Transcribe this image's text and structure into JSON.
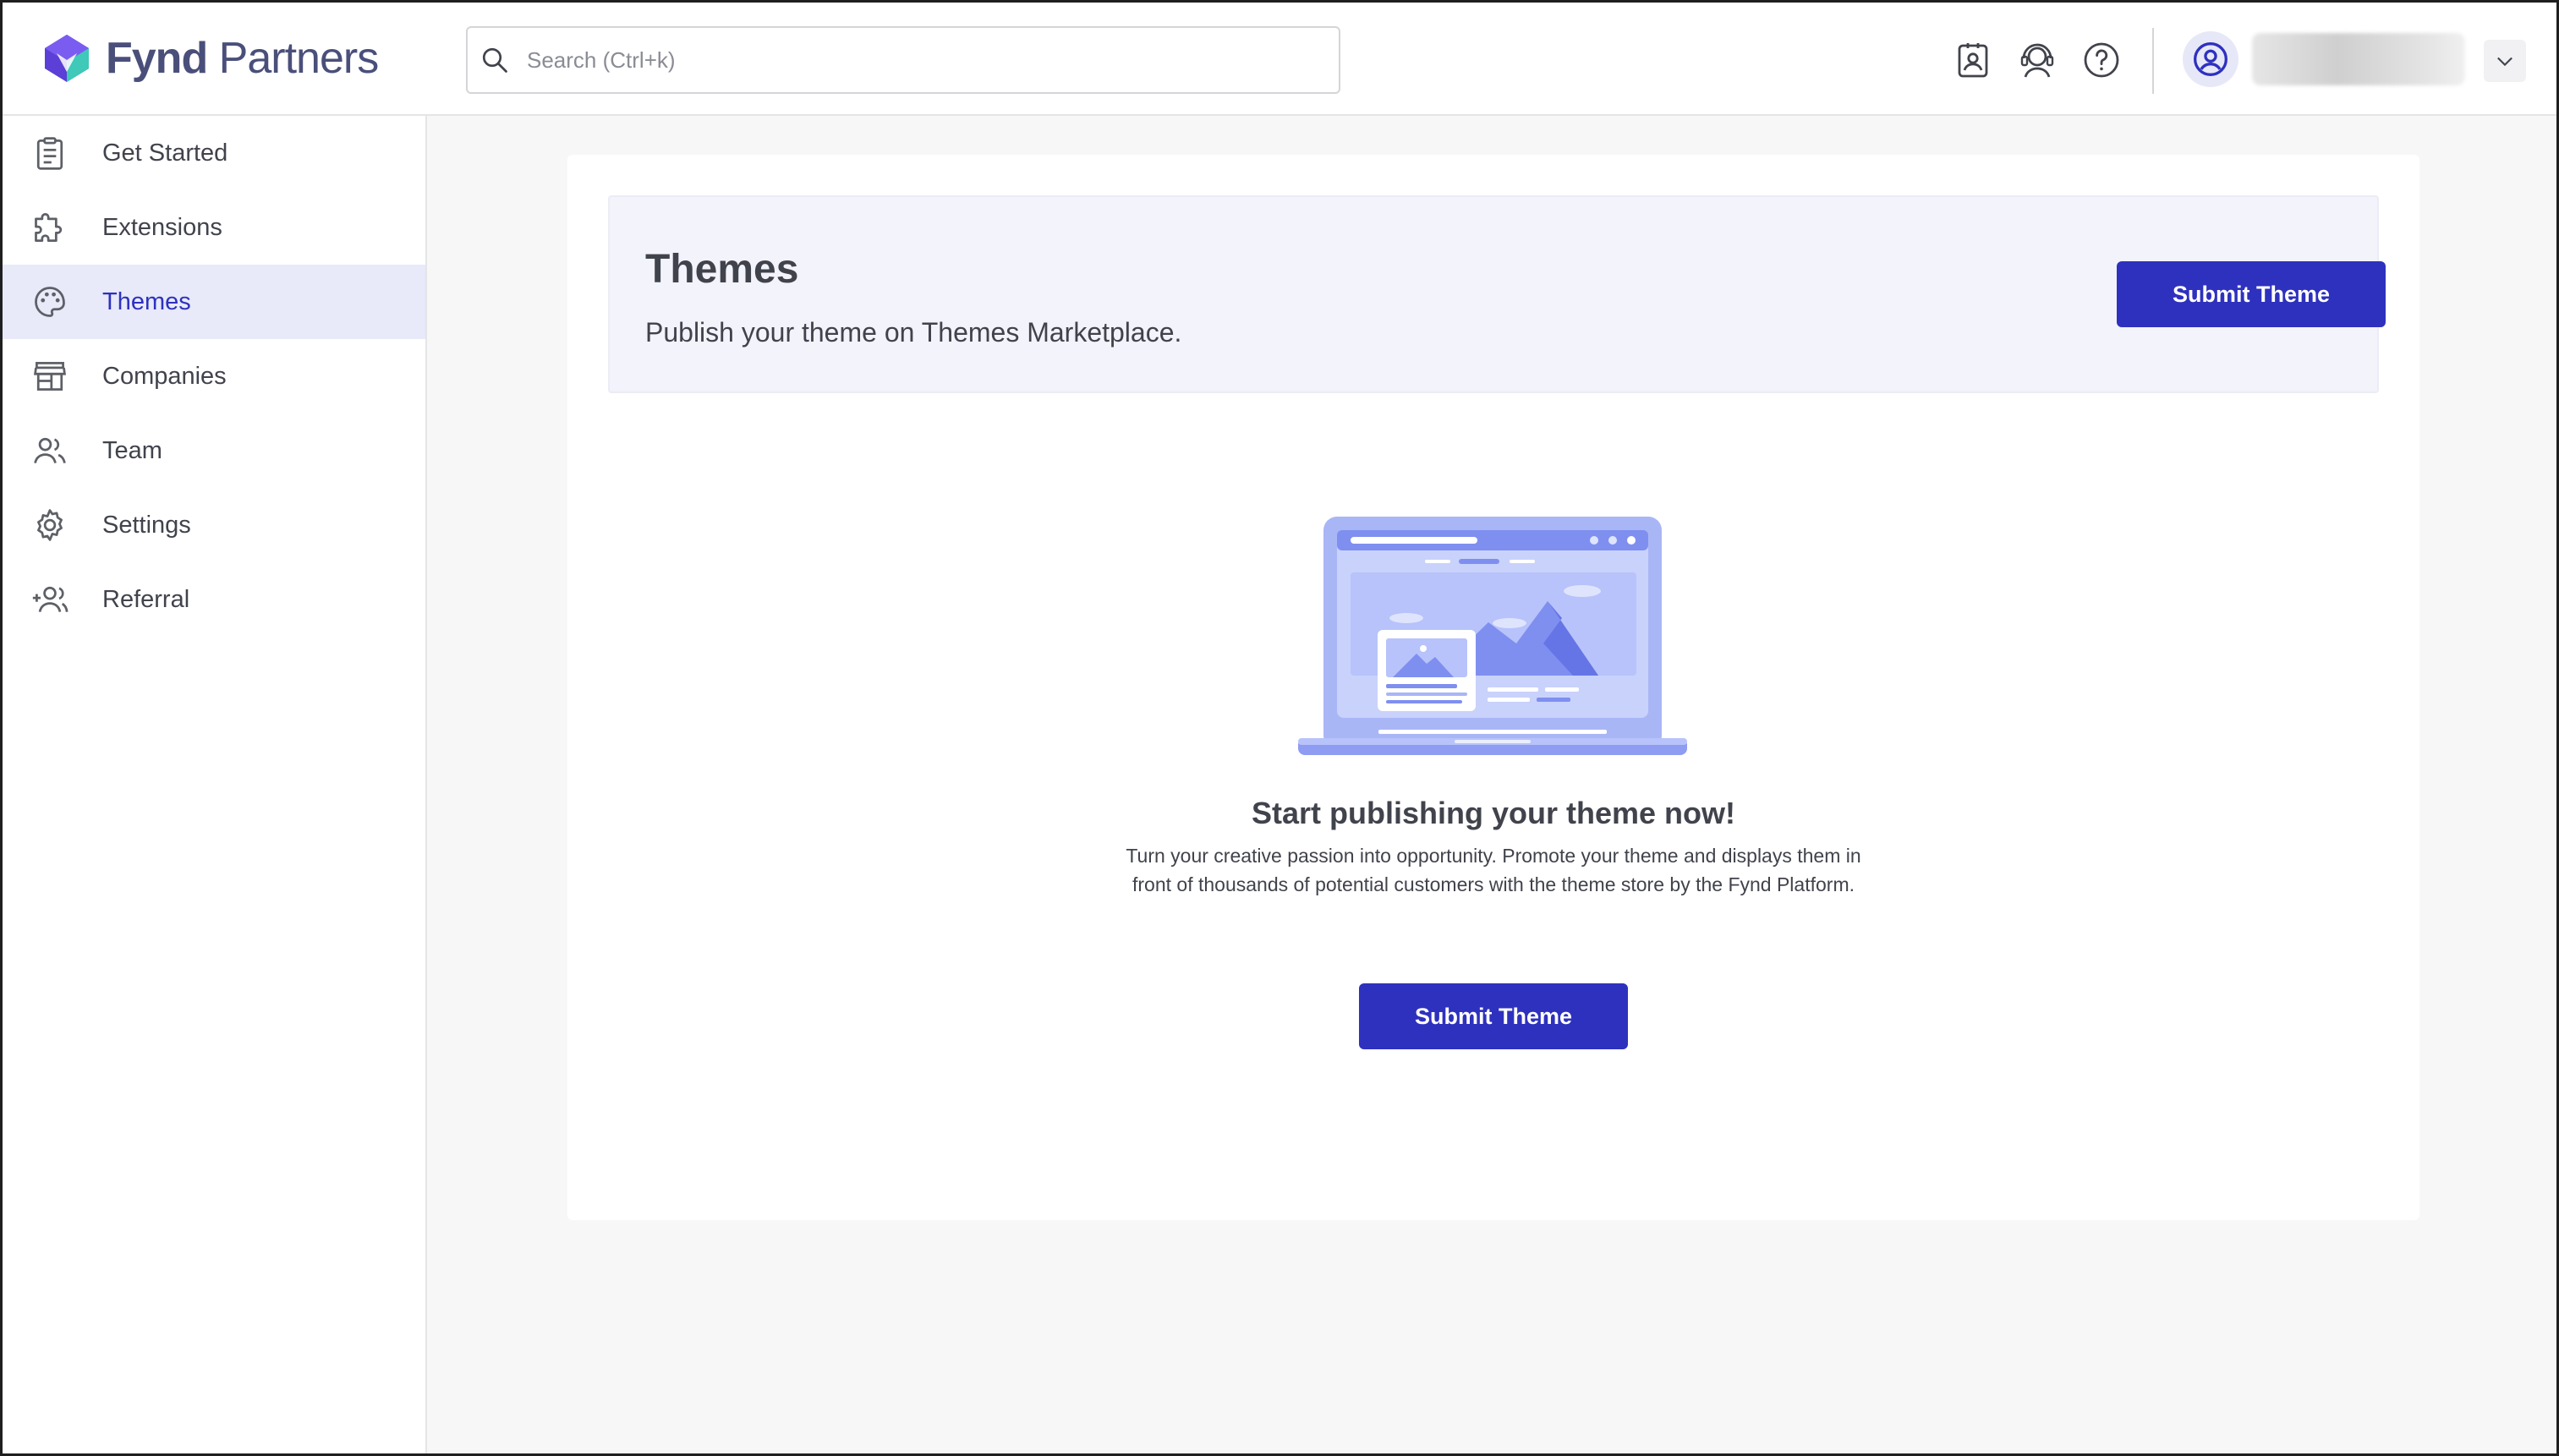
{
  "brand": {
    "name_bold": "Fynd",
    "name_rest": "Partners"
  },
  "search": {
    "placeholder": "Search (Ctrl+k)",
    "value": ""
  },
  "topbar": {
    "icons": [
      "contact-card-icon",
      "support-agent-icon",
      "help-icon"
    ],
    "avatar_icon": "user-circle-icon",
    "menu_icon": "chevron-down-icon"
  },
  "sidebar": {
    "items": [
      {
        "label": "Get Started",
        "icon": "clipboard-icon",
        "active": false
      },
      {
        "label": "Extensions",
        "icon": "puzzle-icon",
        "active": false
      },
      {
        "label": "Themes",
        "icon": "palette-icon",
        "active": true
      },
      {
        "label": "Companies",
        "icon": "store-icon",
        "active": false
      },
      {
        "label": "Team",
        "icon": "team-icon",
        "active": false
      },
      {
        "label": "Settings",
        "icon": "gear-icon",
        "active": false
      },
      {
        "label": "Referral",
        "icon": "add-user-icon",
        "active": false
      }
    ]
  },
  "banner": {
    "title": "Themes",
    "subtitle": "Publish your theme on Themes Marketplace.",
    "button_label": "Submit Theme"
  },
  "empty_state": {
    "title": "Start publishing your theme now!",
    "description": "Turn your creative passion into opportunity. Promote your theme and displays them in front of thousands of potential customers with the theme store by the Fynd Platform.",
    "button_label": "Submit Theme",
    "illustration": "laptop-illustration"
  },
  "colors": {
    "primary": "#2e31be",
    "active_bg": "#e8e9f9",
    "banner_bg": "#f3f3fb",
    "page_bg": "#f7f7f7",
    "text": "#41434c"
  }
}
